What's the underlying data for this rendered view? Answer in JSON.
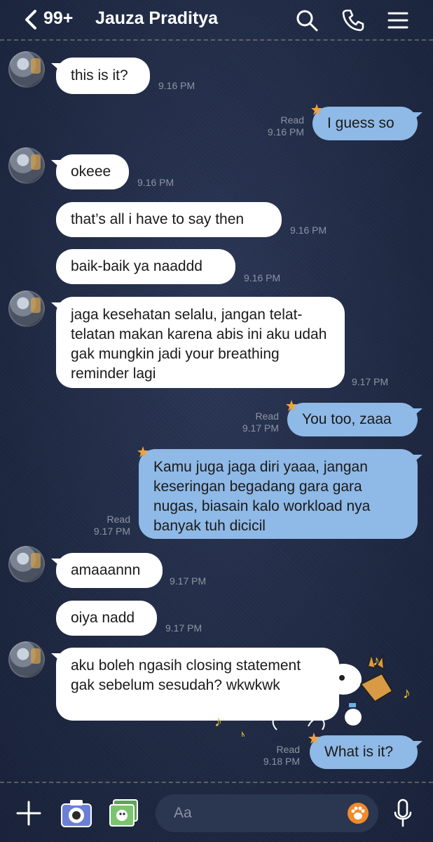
{
  "header": {
    "unread_count": "99+",
    "contact_name": "Jauza Praditya"
  },
  "messages": [
    {
      "side": "in",
      "text": "this is it?",
      "time": "9.16 PM"
    },
    {
      "side": "out",
      "text": "I guess so",
      "status": "Read",
      "time": "9.16 PM"
    },
    {
      "side": "in",
      "text": "okeee",
      "time": "9.16 PM"
    },
    {
      "side": "in",
      "text": "that’s all i have to say then",
      "time": "9.16 PM"
    },
    {
      "side": "in",
      "text": "baik-baik ya naaddd",
      "time": "9.16 PM"
    },
    {
      "side": "in",
      "text": "jaga kesehatan selalu, jangan telat-telatan makan karena abis ini aku udah gak mungkin jadi your breathing reminder lagi",
      "time": "9.17 PM"
    },
    {
      "side": "out",
      "text": "You too, zaaa",
      "status": "Read",
      "time": "9.17 PM"
    },
    {
      "side": "out",
      "text": "Kamu juga jaga diri yaaa, jangan keseringan begadang gara gara nugas, biasain kalo workload nya banyak tuh dicicil",
      "status": "Read",
      "time": "9.17 PM"
    },
    {
      "side": "in",
      "text": "amaaannn",
      "time": "9.17 PM"
    },
    {
      "side": "in",
      "text": "oiya nadd",
      "time": "9.17 PM"
    },
    {
      "side": "in",
      "text": "aku boleh ngasih closing statement gak sebelum sesudah? wkwkwk",
      "time": ""
    },
    {
      "side": "out",
      "text": "What is it?",
      "status": "Read",
      "time": "9.18 PM"
    }
  ],
  "composer": {
    "placeholder": "Aa"
  },
  "icons": {
    "back": "chevron-left-icon",
    "search": "search-icon",
    "call": "phone-icon",
    "menu": "menu-icon",
    "add": "plus-icon",
    "camera": "camera-icon",
    "gallery": "photo-gallery-icon",
    "emoji": "sticker-paw-icon",
    "voice": "microphone-icon"
  },
  "colors": {
    "incoming_bubble": "#ffffff",
    "outgoing_bubble": "#8fb9e6",
    "accent_star": "#f2a33a",
    "background": "#1f2b45"
  }
}
